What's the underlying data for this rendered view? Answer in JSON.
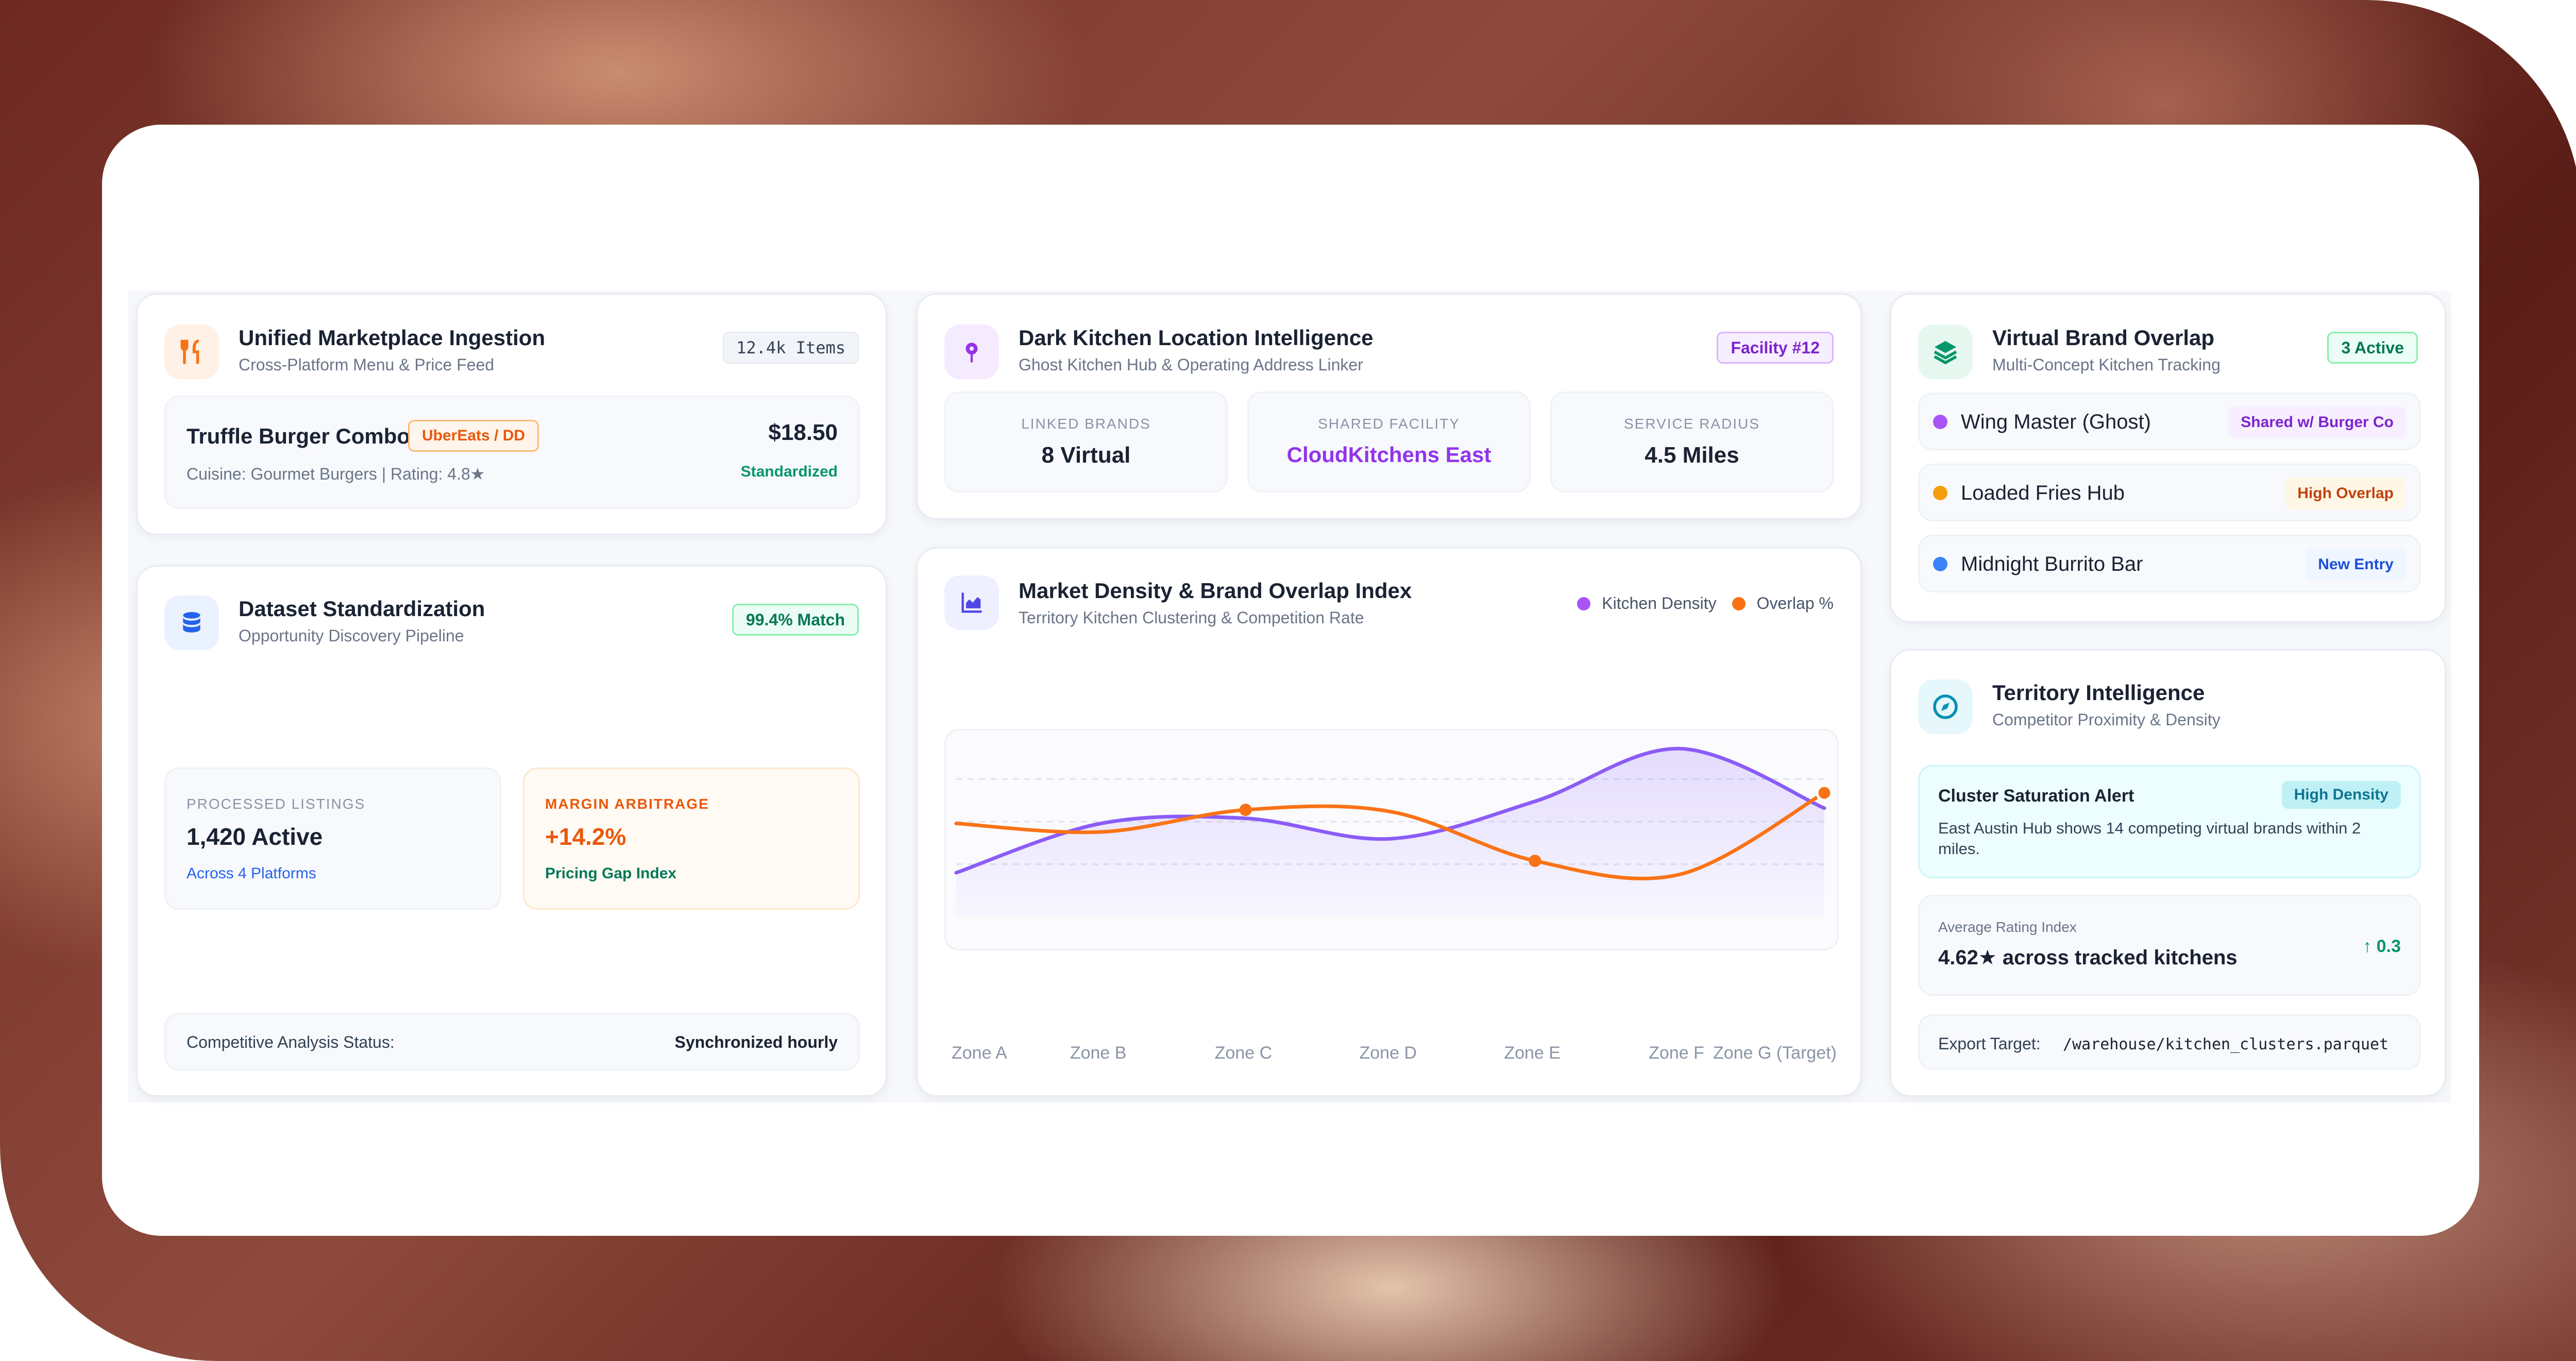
{
  "colors": {
    "orange": "#f97316",
    "purple": "#9333ea",
    "violet_line": "#8b5cf6",
    "green": "#059669",
    "blue": "#2563eb",
    "teal": "#0891b2"
  },
  "ingestion": {
    "title": "Unified Marketplace Ingestion",
    "subtitle": "Cross-Platform Menu & Price Feed",
    "icon": "utensils-icon",
    "badge": "12.4k Items",
    "item_name": "Truffle Burger Combo",
    "item_source": "UberEats / DD",
    "item_meta": "Cuisine: Gourmet Burgers | Rating: 4.8★",
    "item_price": "$18.50",
    "item_status": "Standardized"
  },
  "location": {
    "title": "Dark Kitchen Location Intelligence",
    "subtitle": "Ghost Kitchen Hub & Operating Address Linker",
    "icon": "map-pin-icon",
    "badge": "Facility #12",
    "stats": [
      {
        "label": "Linked Brands",
        "value": "8 Virtual"
      },
      {
        "label": "Shared Facility",
        "value": "CloudKitchens East"
      },
      {
        "label": "Service Radius",
        "value": "4.5 Miles"
      }
    ]
  },
  "overlap": {
    "title": "Virtual Brand Overlap",
    "subtitle": "Multi-Concept Kitchen Tracking",
    "icon": "layers-icon",
    "badge": "3 Active",
    "brands": [
      {
        "name": "Wing Master (Ghost)",
        "tag": "Shared w/ Burger Co",
        "color": "#a855f7"
      },
      {
        "name": "Loaded Fries Hub",
        "tag": "High Overlap",
        "color": "#f59e0b"
      },
      {
        "name": "Midnight Burrito Bar",
        "tag": "New Entry",
        "color": "#3b82f6"
      }
    ]
  },
  "standardization": {
    "title": "Dataset Standardization",
    "subtitle": "Opportunity Discovery Pipeline",
    "icon": "database-icon",
    "badge": "99.4% Match",
    "processed_label": "Processed Listings",
    "processed_value": "1,420 Active",
    "processed_note": "Across 4 Platforms",
    "margin_label": "Margin Arbitrage",
    "margin_value": "+14.2%",
    "margin_note": "Pricing Gap Index",
    "status_label": "Competitive Analysis Status:",
    "status_value": "Synchronized hourly"
  },
  "density": {
    "title": "Market Density & Brand Overlap Index",
    "subtitle": "Territory Kitchen Clustering & Competition Rate",
    "icon": "chart-icon",
    "legend": [
      "Kitchen Density",
      "Overlap %"
    ]
  },
  "chart_data": {
    "type": "line",
    "categories": [
      "Zone A",
      "Zone B",
      "Zone C",
      "Zone D",
      "Zone E",
      "Zone F",
      "Zone G (Target)"
    ],
    "series": [
      {
        "name": "Kitchen Density",
        "color": "#8b5cf6",
        "values": [
          0.26,
          0.55,
          0.58,
          0.46,
          0.68,
          0.99,
          0.64
        ],
        "area": true
      },
      {
        "name": "Overlap %",
        "color": "#f97316",
        "values": [
          0.55,
          0.5,
          0.63,
          0.62,
          0.33,
          0.25,
          0.73
        ]
      }
    ],
    "ylim": [
      0,
      1
    ],
    "grid": true,
    "legend_position": "top-right"
  },
  "territory": {
    "title": "Territory Intelligence",
    "subtitle": "Competitor Proximity & Density",
    "icon": "compass-icon",
    "alert_title": "Cluster Saturation Alert",
    "alert_badge": "High Density",
    "alert_text": "East Austin Hub shows 14 competing virtual brands within 2 miles.",
    "rating_label": "Average Rating Index",
    "rating_value": "4.62★ across tracked kitchens",
    "rating_delta": "↑ 0.3",
    "export_label": "Export Target:",
    "export_path": "/warehouse/kitchen_clusters.parquet"
  }
}
